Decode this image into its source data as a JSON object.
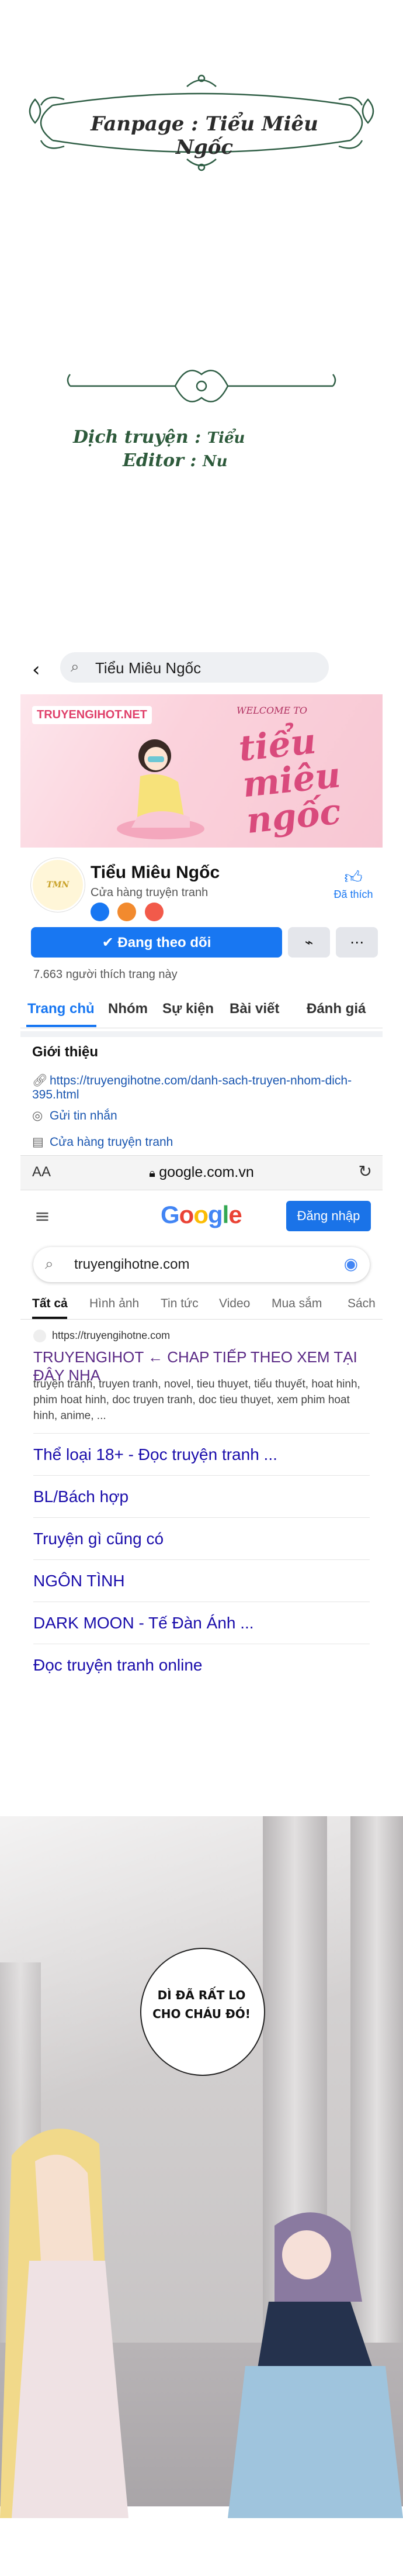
{
  "banner": {
    "fanpage": "Fanpage : Tiểu Miêu Ngốc",
    "translator_label": "Dịch truyện :",
    "translator_name": "Tiểu",
    "editor_label": "Editor :",
    "editor_name": "Nu"
  },
  "fb": {
    "search_query": "Tiểu Miêu Ngốc",
    "cover_logo": "TRUYENGIHOT.NET",
    "cover_welcome": "WELCOME TO",
    "cover_script": "tiểu miêu ngốc",
    "page_name": "Tiểu Miêu Ngốc",
    "page_category": "Cửa hàng truyện tranh",
    "like_label": "Đã thích",
    "follow_label": "Đang theo dõi",
    "like_count": "7.663 người thích trang này",
    "tabs": [
      "Trang chủ",
      "Nhóm",
      "Sự kiện",
      "Bài viết",
      "Đánh giá"
    ],
    "intro_heading": "Giới thiệu",
    "intro_rows": [
      {
        "icon": "link-icon",
        "text": "https://truyengihotne.com/danh-sach-truyen-nhom-dich-395.html"
      },
      {
        "icon": "messenger-icon",
        "text": "Gửi tin nhắn"
      },
      {
        "icon": "shop-icon",
        "text": "Cửa hàng truyện tranh"
      }
    ]
  },
  "browser": {
    "aa": "AA",
    "url": "google.com.vn"
  },
  "google": {
    "logo": "Google",
    "signin": "Đăng nhập",
    "query": "truyengihotne.com",
    "tabs": [
      "Tất cả",
      "Hình ảnh",
      "Tin tức",
      "Video",
      "Mua sắm",
      "Sách"
    ],
    "result_url": "https://truyengihotne.com",
    "result_title": "TRUYENGIHOT ← CHAP TIẾP THEO XEM TẠI ĐÂY NHA",
    "result_snippet": "truyện tranh, truyen tranh, novel, tieu thuyet, tiểu thuyết, hoat hinh, phim hoat hinh, doc truyen tranh, doc tieu thuyet, xem phim hoat hinh, anime, ...",
    "sitelinks": [
      "Thể loại 18+ - Đọc truyện tranh ...",
      "BL/Bách hợp",
      "Truyện gì cũng có",
      "NGÔN TÌNH",
      "DARK MOON - Tế Đàn Ánh ...",
      "Đọc truyện tranh online"
    ]
  },
  "comic": {
    "speech": "DÌ ĐÃ RẤT LO CHO CHÁU ĐÓ!"
  }
}
